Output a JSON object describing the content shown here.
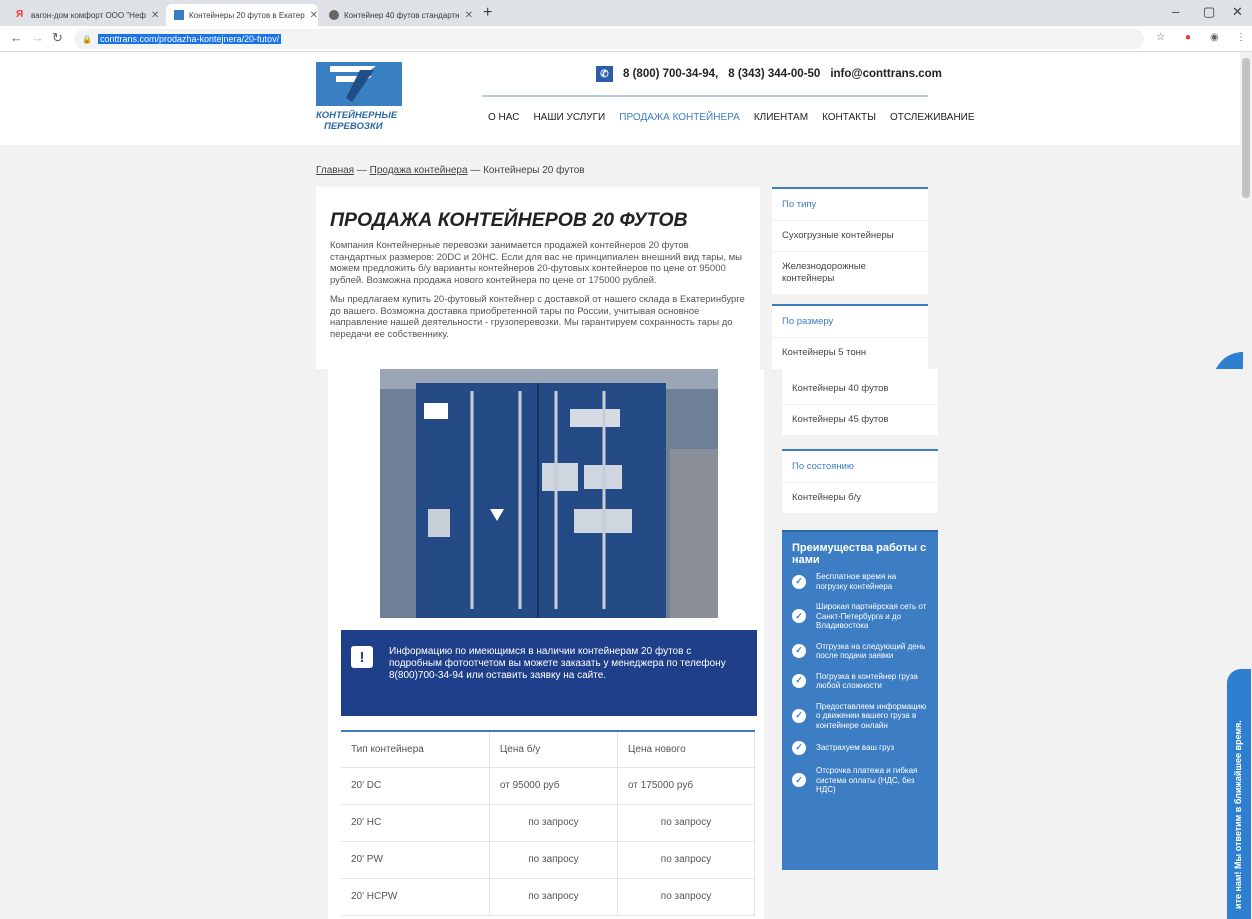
{
  "browser": {
    "tabs": [
      {
        "title": "вагон-дом комфорт ООО \"Неф",
        "close": "✕"
      },
      {
        "title": "Контейнеры 20 футов в Екатер",
        "close": "✕"
      },
      {
        "title": "Контейнер 40 футов стандартн",
        "close": "✕"
      }
    ],
    "new_tab": "+",
    "url": "conttrans.com/prodazha-kontejnera/20-futov/",
    "window_controls": [
      "–",
      "▢",
      "✕"
    ]
  },
  "header": {
    "logo_line1": "КОНТЕЙНЕРНЫЕ",
    "logo_line2": "ПЕРЕВОЗКИ",
    "phone1": "8 (800) 700-34-94,",
    "phone2": "8 (343) 344-00-50",
    "email": "info@conttrans.com",
    "nav": [
      "О НАС",
      "НАШИ УСЛУГИ",
      "ПРОДАЖА КОНТЕЙНЕРА",
      "КЛИЕНТАМ",
      "КОНТАКТЫ",
      "ОТСЛЕЖИВАНИЕ"
    ]
  },
  "breadcrumb": {
    "home": "Главная",
    "sep": " — ",
    "section": "Продажа контейнера",
    "current": "Контейнеры 20 футов"
  },
  "content": {
    "title": "ПРОДАЖА КОНТЕЙНЕРОВ 20 ФУТОВ",
    "p1": "Компания Контейнерные перевозки занимается продажей контейнеров 20 футов стандартных размеров: 20DC и 20HC. Если для вас не принципиален внешний вид тары, мы можем предложить б/у варианты контейнеров 20-футовых контейнеров по цене от 95000 рублей. Возможна продажа нового контейнера по цене от 175000 рублей.",
    "p2": "Мы предлагаем купить 20-футовый контейнер с доставкой от нашего склада в Екатеринбурге до вашего. Возможна доставка приобретенной тары по России, учитывая основное направление нашей деятельности - грузоперевозки. Мы гарантируем сохранность тары до передачи ее собственнику.",
    "info": "Информацию по имеющимся в наличии контейнерам 20 футов с подробным фотоотчетом вы можете заказать у менеджера по телефону 8(800)700-34-94 или оставить заявку на сайте."
  },
  "sidebar": {
    "by_type": {
      "head": "По типу",
      "items": [
        "Сухогрузные контейнеры",
        "Железнодорожные контейнеры"
      ]
    },
    "by_size": {
      "head": "По размеру",
      "items": [
        "Контейнеры 5 тонн",
        "Контейнеры 40 футов",
        "Контейнеры 45 футов"
      ]
    },
    "by_state": {
      "head": "По состоянию",
      "items": [
        "Контейнеры б/у"
      ]
    }
  },
  "advantages": {
    "title": "Преимущества работы с нами",
    "items": [
      "Бесплатное время на погрузку контейнера",
      "Широкая партнёрская сеть от Санкт-Петербурга и до Владивостока",
      "Отгрузка на следующий день после подачи заявки",
      "Погрузка в контейнер груза любой сложности",
      "Предоставляем информацию о движении вашего груза в контейнере онлайн",
      "Застрахуем ваш груз",
      "Отсрочка платежа и гибкая система оплаты (НДС, без НДС)"
    ]
  },
  "price_table": {
    "headers": [
      "Тип контейнера",
      "Цена б/у",
      "Цена нового"
    ],
    "rows": [
      [
        "20' DC",
        "от 95000 руб",
        "от 175000 руб"
      ],
      [
        "20' HC",
        "по запросу",
        "по запросу"
      ],
      [
        "20' PW",
        "по запросу",
        "по запросу"
      ],
      [
        "20' HCPW",
        "по запросу",
        "по запросу"
      ]
    ]
  },
  "callback_tab": "ите нам! Мы ответим в ближайшее время."
}
